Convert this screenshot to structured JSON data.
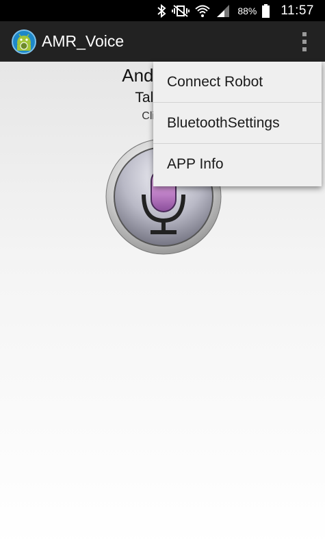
{
  "status_bar": {
    "battery_percent": "88%",
    "time": "11:57",
    "icons": [
      "bluetooth-icon",
      "mute-vibrate-icon",
      "wifi-icon",
      "signal-icon",
      "battery-icon"
    ]
  },
  "action_bar": {
    "app_title": "AMR_Voice",
    "icons": [
      "app-logo-icon",
      "overflow-menu-icon"
    ]
  },
  "main": {
    "heading": "Android M",
    "subheading": "Talk to Y",
    "hint": "Click bel",
    "mic_icon": "microphone-icon"
  },
  "menu": {
    "items": [
      {
        "label": "Connect Robot"
      },
      {
        "label": "BluetoothSettings"
      },
      {
        "label": "APP Info"
      }
    ]
  },
  "colors": {
    "status_bar_bg": "#000000",
    "action_bar_bg": "#222222",
    "menu_bg": "#efefef"
  }
}
